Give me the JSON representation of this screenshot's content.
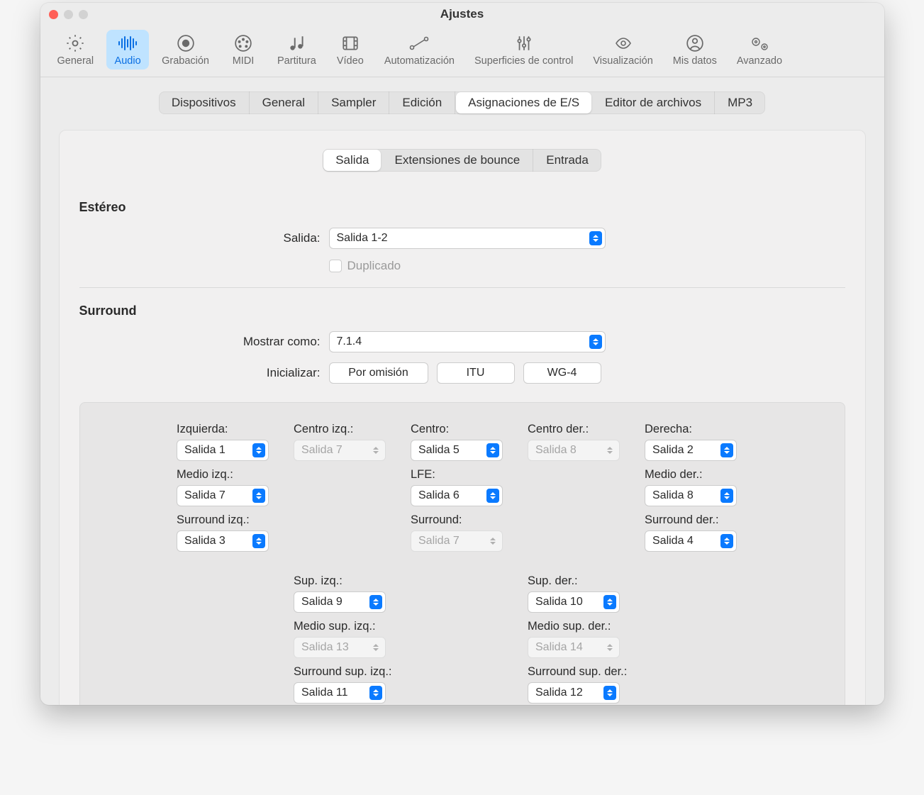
{
  "window": {
    "title": "Ajustes"
  },
  "toolbar": {
    "general": "General",
    "audio": "Audio",
    "recording": "Grabación",
    "midi": "MIDI",
    "score": "Partitura",
    "video": "Vídeo",
    "automation": "Automatización",
    "controlSurfaces": "Superficies de control",
    "display": "Visualización",
    "myData": "Mis datos",
    "advanced": "Avanzado"
  },
  "tabs": {
    "devices": "Dispositivos",
    "general": "General",
    "sampler": "Sampler",
    "editing": "Edición",
    "ioAssignments": "Asignaciones de E/S",
    "fileEditor": "Editor de archivos",
    "mp3": "MP3"
  },
  "subtabs": {
    "output": "Salida",
    "bounceExtensions": "Extensiones de bounce",
    "input": "Entrada"
  },
  "stereo": {
    "title": "Estéreo",
    "outputLabel": "Salida:",
    "outputValue": "Salida 1-2",
    "duplicateLabel": "Duplicado"
  },
  "surround": {
    "title": "Surround",
    "showAsLabel": "Mostrar como:",
    "showAsValue": "7.1.4",
    "initializeLabel": "Inicializar:",
    "defaultBtn": "Por omisión",
    "ituBtn": "ITU",
    "wg4Btn": "WG-4"
  },
  "channels": {
    "left": {
      "label": "Izquierda:",
      "value": "Salida 1",
      "disabled": false
    },
    "centerLeft": {
      "label": "Centro izq.:",
      "value": "Salida 7",
      "disabled": true
    },
    "center": {
      "label": "Centro:",
      "value": "Salida 5",
      "disabled": false
    },
    "centerRight": {
      "label": "Centro der.:",
      "value": "Salida 8",
      "disabled": true
    },
    "right": {
      "label": "Derecha:",
      "value": "Salida 2",
      "disabled": false
    },
    "midLeft": {
      "label": "Medio izq.:",
      "value": "Salida 7",
      "disabled": false
    },
    "lfe": {
      "label": "LFE:",
      "value": "Salida 6",
      "disabled": false
    },
    "midRight": {
      "label": "Medio der.:",
      "value": "Salida 8",
      "disabled": false
    },
    "surroundLeft": {
      "label": "Surround izq.:",
      "value": "Salida 3",
      "disabled": false
    },
    "surround": {
      "label": "Surround:",
      "value": "Salida 7",
      "disabled": true
    },
    "surroundRight": {
      "label": "Surround der.:",
      "value": "Salida 4",
      "disabled": false
    },
    "topLeft": {
      "label": "Sup. izq.:",
      "value": "Salida 9",
      "disabled": false
    },
    "topRight": {
      "label": "Sup. der.:",
      "value": "Salida 10",
      "disabled": false
    },
    "topMidLeft": {
      "label": "Medio sup. izq.:",
      "value": "Salida 13",
      "disabled": true
    },
    "topMidRight": {
      "label": "Medio sup. der.:",
      "value": "Salida 14",
      "disabled": true
    },
    "topSurrLeft": {
      "label": "Surround sup. izq.:",
      "value": "Salida 11",
      "disabled": false
    },
    "topSurrRight": {
      "label": "Surround sup. der.:",
      "value": "Salida 12",
      "disabled": false
    }
  }
}
